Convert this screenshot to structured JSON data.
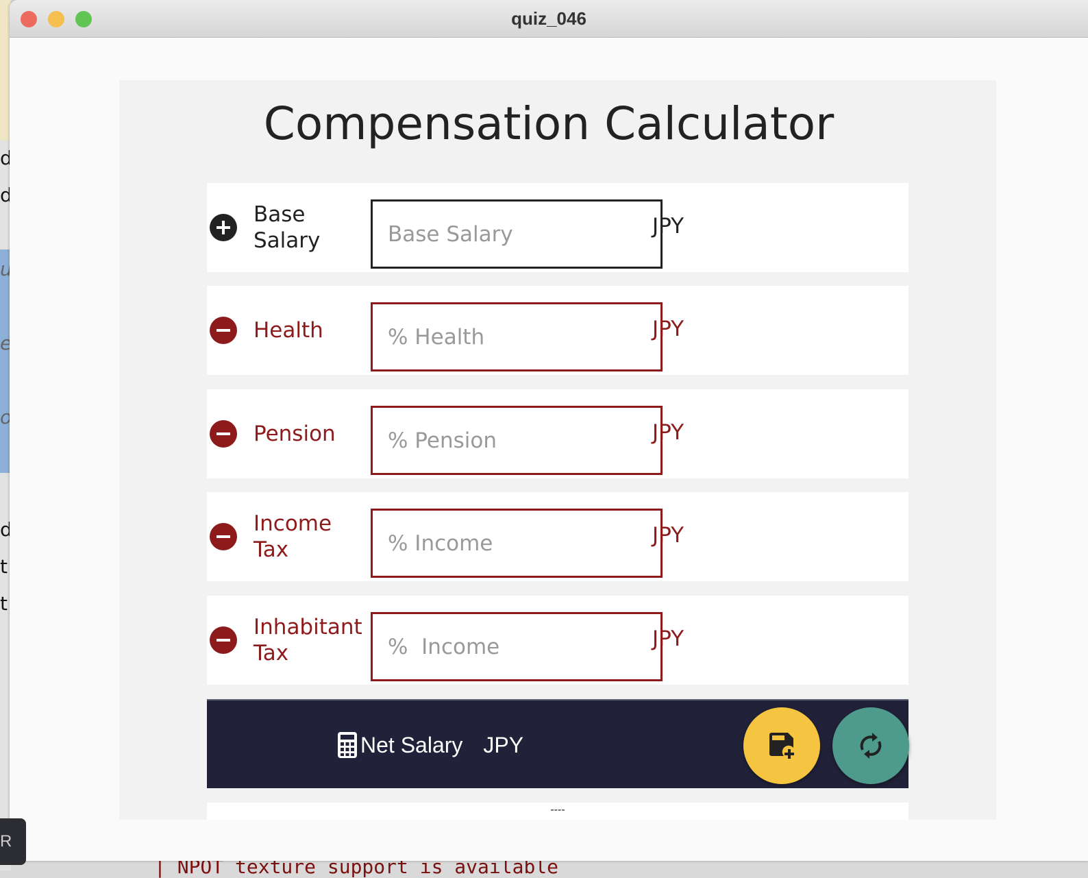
{
  "window": {
    "title": "quiz_046"
  },
  "background": {
    "fragments": [
      "d",
      "d",
      "u",
      "e",
      "o",
      "d",
      "t",
      "t"
    ],
    "terminal_text": "| NPOT texture support is available",
    "badge": "R"
  },
  "app": {
    "heading": "Compensation Calculator",
    "rows": [
      {
        "label": "Base Salary",
        "placeholder": "Base Salary",
        "value": "",
        "unit": "JPY",
        "icon": "plus-circle-icon"
      },
      {
        "label": "Health",
        "placeholder": "% Health",
        "value": "",
        "unit": "JPY",
        "icon": "minus-circle-icon"
      },
      {
        "label": "Pension",
        "placeholder": "% Pension",
        "value": "",
        "unit": "JPY",
        "icon": "minus-circle-icon"
      },
      {
        "label": "Income Tax",
        "placeholder": "% Income",
        "value": "",
        "unit": "JPY",
        "icon": "minus-circle-icon"
      },
      {
        "label": "Inhabitant Tax",
        "placeholder": "%  Income",
        "value": "",
        "unit": "JPY",
        "icon": "minus-circle-icon"
      }
    ],
    "net": {
      "label": "Net Salary",
      "unit": "JPY",
      "icon": "calculator-icon"
    },
    "buttons": {
      "save_icon": "save-add-icon",
      "reset_icon": "refresh-icon"
    },
    "footer": "----"
  },
  "colors": {
    "deduction": "#8e1b1b",
    "net_bar": "#212239",
    "save": "#f5c542",
    "reset": "#4e9a8c"
  }
}
